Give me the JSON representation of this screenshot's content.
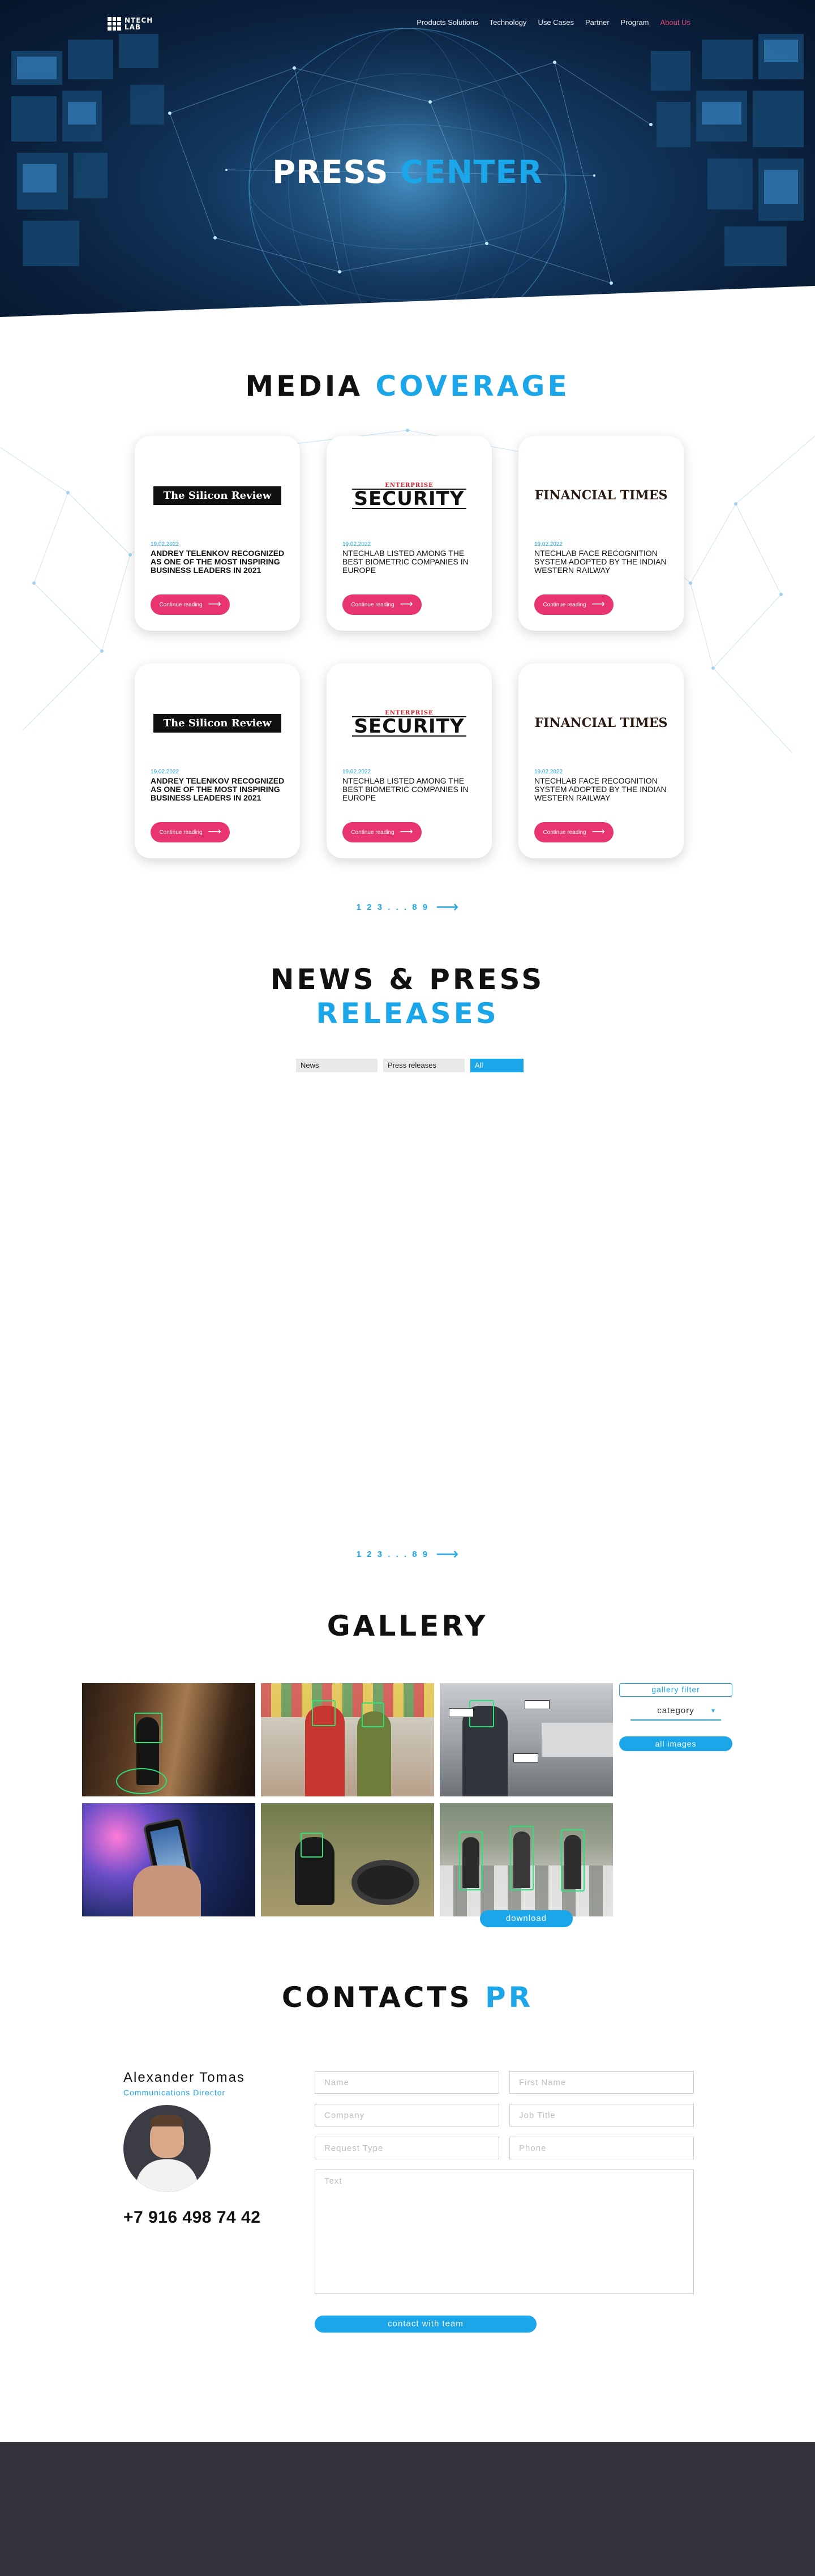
{
  "nav": {
    "logo_line1": "NTECH",
    "logo_line2": "LAB",
    "items": [
      {
        "label": "Products Solutions"
      },
      {
        "label": "Technology"
      },
      {
        "label": "Use Cases"
      },
      {
        "label": "Partner"
      },
      {
        "label": "Program"
      },
      {
        "label": "About Us",
        "active": true
      }
    ]
  },
  "hero": {
    "title_white": "PRESS",
    "title_blue": "CENTER"
  },
  "media": {
    "title_black": "MEDIA",
    "title_blue": "COVERAGE",
    "cards": [
      {
        "logo": "The Silicon Review",
        "logo_style": "silicon",
        "date": "19.02.2022",
        "title": "ANDREY TELENKOV RECOGNIZED AS ONE OF THE MOST INSPIRING BUSINESS LEADERS IN 2021",
        "button": "Continue reading"
      },
      {
        "logo_top": "ENTERPRISE",
        "logo": "SECURITY",
        "logo_style": "security",
        "date": "19.02.2022",
        "title": "NTECHLAB LISTED AMONG THE BEST BIOMETRIC COMPANIES IN EUROPE",
        "button": "Continue reading"
      },
      {
        "logo": "FINANCIAL TIMES",
        "logo_style": "ft",
        "date": "19.02.2022",
        "title": "NTECHLAB FACE RECOGNITION SYSTEM ADOPTED BY THE INDIAN WESTERN RAILWAY",
        "button": "Continue reading"
      },
      {
        "logo": "The Silicon Review",
        "logo_style": "silicon",
        "date": "19.02.2022",
        "title": "ANDREY TELENKOV RECOGNIZED AS ONE OF THE MOST INSPIRING BUSINESS LEADERS IN 2021",
        "button": "Continue reading"
      },
      {
        "logo_top": "ENTERPRISE",
        "logo": "SECURITY",
        "logo_style": "security",
        "date": "19.02.2022",
        "title": "NTECHLAB LISTED AMONG THE BEST BIOMETRIC COMPANIES IN EUROPE",
        "button": "Continue reading"
      },
      {
        "logo": "FINANCIAL TIMES",
        "logo_style": "ft",
        "date": "19.02.2022",
        "title": "NTECHLAB FACE RECOGNITION SYSTEM ADOPTED BY THE INDIAN WESTERN RAILWAY",
        "button": "Continue reading"
      }
    ],
    "pager": "1 2 3 . . . 8 9"
  },
  "news": {
    "title_black": "NEWS & PRESS",
    "title_blue": "RELEASES",
    "tabs": [
      {
        "label": "News"
      },
      {
        "label": "Press releases"
      },
      {
        "label": "All",
        "active": true
      }
    ],
    "pager": "1 2 3 . . . 8 9"
  },
  "gallery": {
    "title": "GALLERY",
    "filter_title": "gallery filter",
    "category": "category",
    "all_images": "all images",
    "download": "download"
  },
  "contacts": {
    "title_black": "CONTACTS",
    "title_blue": "PR",
    "name": "Alexander Tomas",
    "role": "Communications Director",
    "phone": "+7 916 498 74 42",
    "form": {
      "name": "Name",
      "first_name": "First Name",
      "company": "Company",
      "job_title": "Job Title",
      "request_type": "Request Type",
      "phone": "Phone",
      "text": "Text"
    },
    "submit": "contact with team"
  },
  "colors": {
    "accent_blue": "#1aa6e8",
    "accent_pink": "#e8346f",
    "footer": "#34353c"
  }
}
